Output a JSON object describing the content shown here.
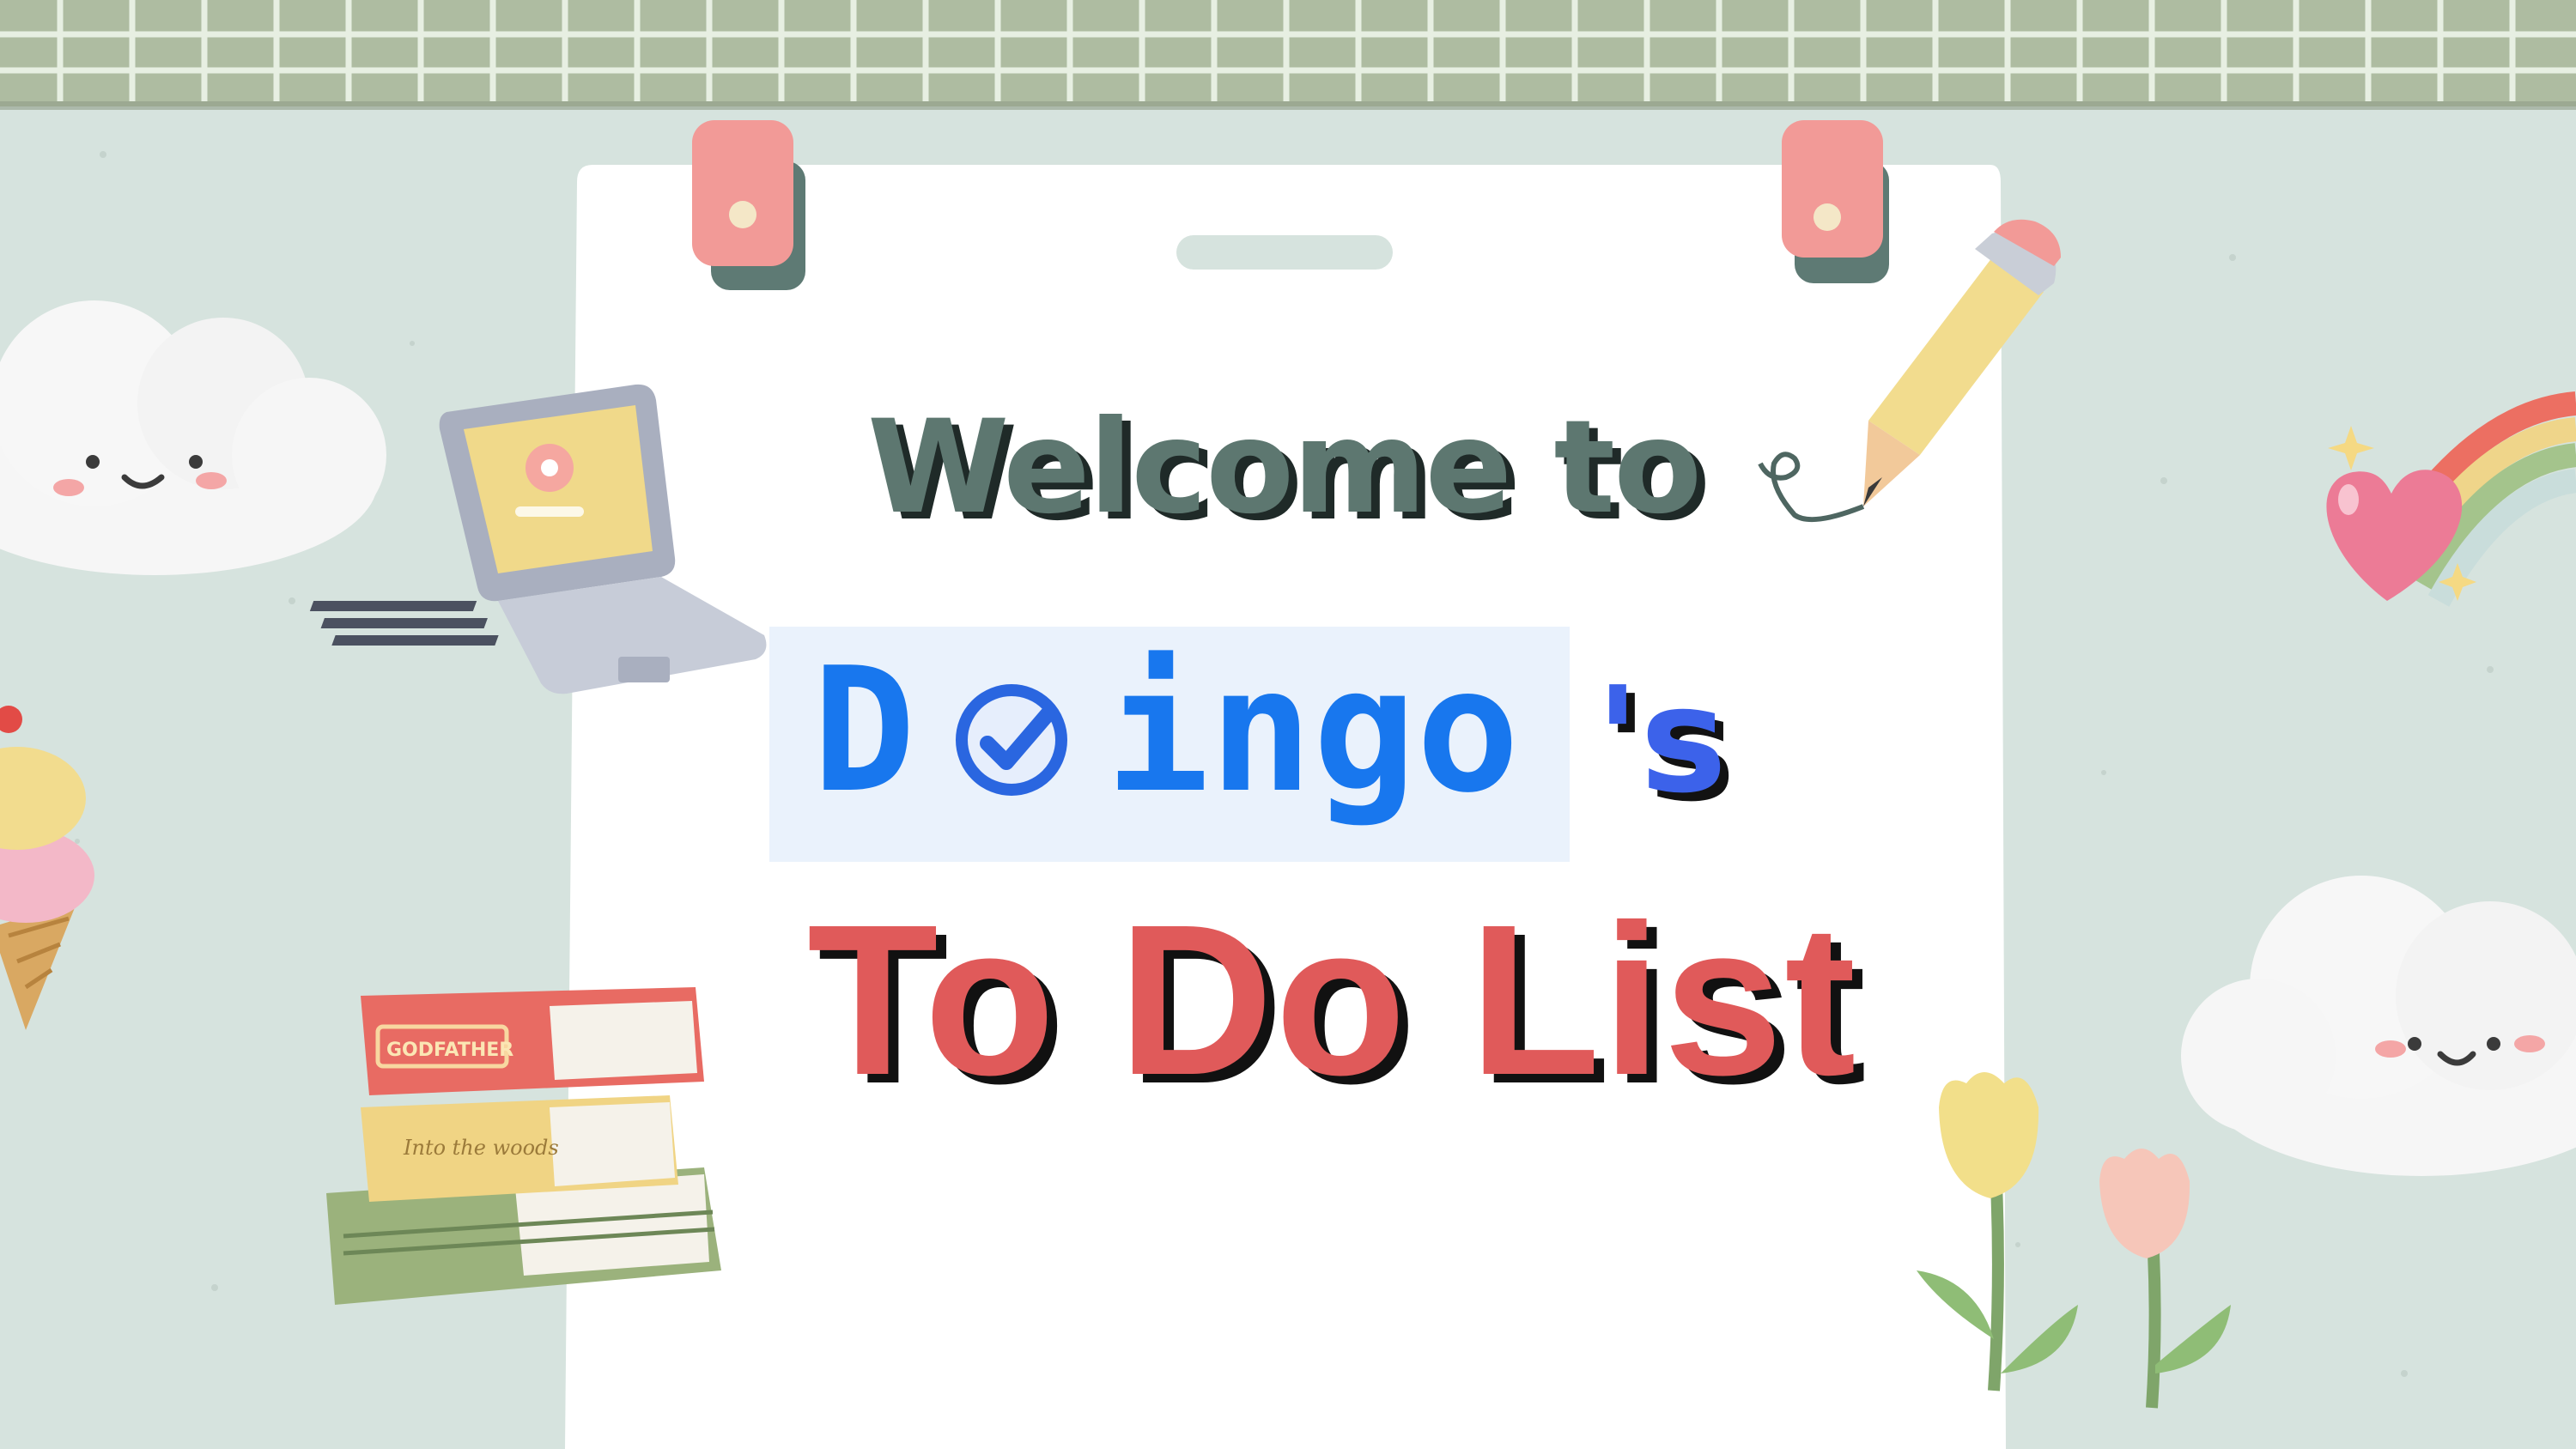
{
  "colors": {
    "background": "#d6e3de",
    "grid_strip": "#aebca1",
    "paper": "#ffffff",
    "welcome_text": "#5d7770",
    "brand_blue": "#1877ee",
    "todo_red": "#e05a5a"
  },
  "heading": {
    "welcome": "Welcome to",
    "brand_initial": "D",
    "brand_rest": "ingo",
    "possessive": "'s",
    "subtitle": "To Do List"
  },
  "books": {
    "top_spine": "GODFATHER",
    "middle_spine": "Into the woods"
  },
  "icons": [
    "check-circle-icon",
    "laptop-icon",
    "pencil-icon",
    "books-icon",
    "cloud-icon",
    "rainbow-icon",
    "heart-icon",
    "ice-cream-icon",
    "tulip-icon",
    "binder-clip-icon"
  ]
}
